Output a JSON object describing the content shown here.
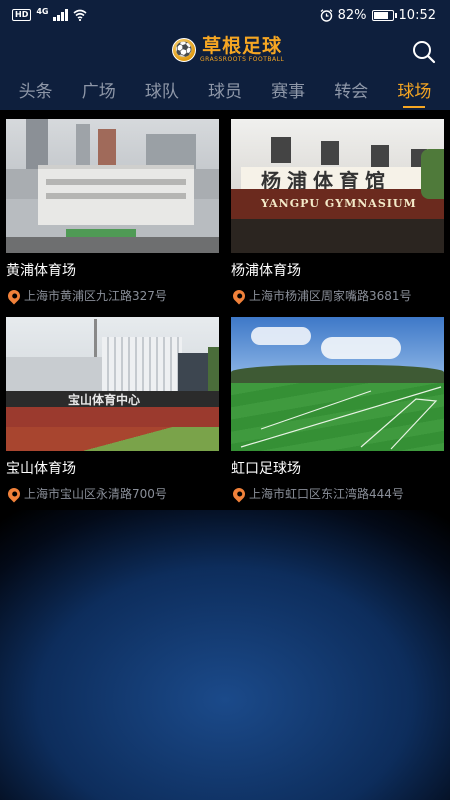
{
  "status_bar": {
    "hd": "HD",
    "network": "4G",
    "battery_percent": "82%",
    "battery_level": 0.82,
    "time": "10:52"
  },
  "header": {
    "logo_main": "草根足球",
    "logo_sub": "GRASSROOTS FOOTBALL",
    "search_icon": "search-icon"
  },
  "tabs": [
    {
      "label": "头条",
      "active": false
    },
    {
      "label": "广场",
      "active": false
    },
    {
      "label": "球队",
      "active": false
    },
    {
      "label": "球员",
      "active": false
    },
    {
      "label": "赛事",
      "active": false
    },
    {
      "label": "转会",
      "active": false
    },
    {
      "label": "球场",
      "active": true
    }
  ],
  "venues": [
    {
      "name": "黄浦体育场",
      "address": "上海市黄浦区九江路327号"
    },
    {
      "name": "杨浦体育场",
      "address": "上海市杨浦区周家嘴路3681号",
      "sign_cn": "杨浦体育馆",
      "sign_en": "YANGPU GYMNASIUM"
    },
    {
      "name": "宝山体育场",
      "address": "上海市宝山区永清路700号",
      "sign_cn": "宝山体育中心"
    },
    {
      "name": "虹口足球场",
      "address": "上海市虹口区东江湾路444号"
    }
  ],
  "colors": {
    "accent": "#f5a623",
    "header_bg": "#0e1f3d",
    "pin": "#f0813a"
  }
}
